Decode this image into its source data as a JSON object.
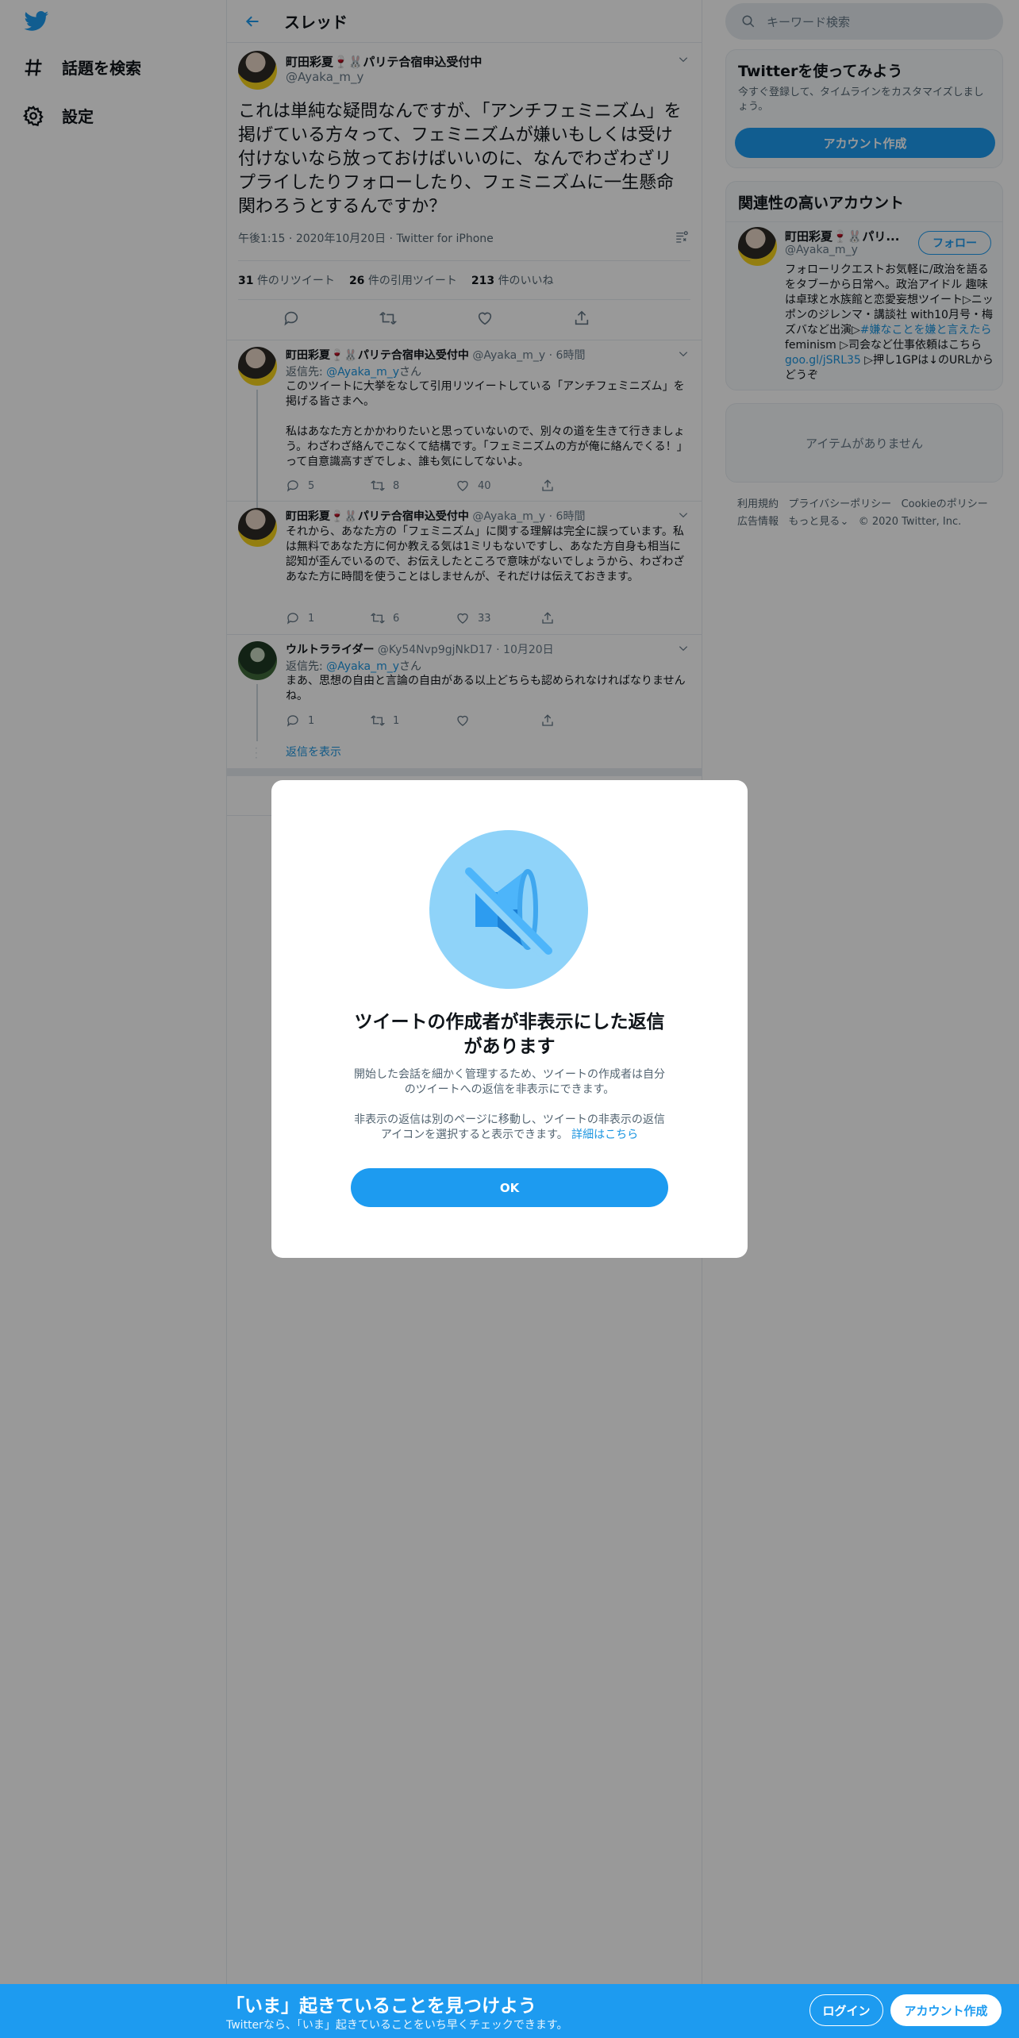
{
  "nav": {
    "explore_label": "話題を検索",
    "settings_label": "設定"
  },
  "header": {
    "title": "スレッド"
  },
  "main_tweet": {
    "name": "町田彩夏🍷🐰パリテ合宿申込受付中",
    "handle": "@Ayaka_m_y",
    "text": "これは単純な疑問なんですが、「アンチフェミニズム」を掲げている方々って、フェミニズムが嫌いもしくは受け付けないなら放っておけばいいのに、なんでわざわざリプライしたりフォローしたり、フェミニズムに一生懸命関わろうとするんですか？",
    "time": "午後1:15",
    "date": "2020年10月20日",
    "source": "Twitter for iPhone",
    "retweets_count": "31",
    "retweets_label": "件のリツイート",
    "quotes_count": "26",
    "quotes_label": "件の引用ツイート",
    "likes_count": "213",
    "likes_label": "件のいいね"
  },
  "replies": [
    {
      "name": "町田彩夏🍷🐰パリテ合宿申込受付中",
      "handle": "@Ayaka_m_y",
      "time": "6時間",
      "reply_to_prefix": "返信先: ",
      "reply_to": "@Ayaka_m_y",
      "reply_to_suffix": "さん",
      "text": "このツイートに大挙をなして引用リツイートしている「アンチフェミニズム」を掲げる皆さまへ。\n\n私はあなた方とかかわりたいと思っていないので、別々の道を生きて行きましょう。わざわざ絡んでこなくて結構です。「フェミニズムの方が俺に絡んでくる！」って自意識高すぎでしょ、誰も気にしてないよ。",
      "replies": "5",
      "retweets": "8",
      "likes": "40"
    },
    {
      "name": "町田彩夏🍷🐰パリテ合宿申込受付中",
      "handle": "@Ayaka_m_y",
      "time": "6時間",
      "text": "それから、あなた方の「フェミニズム」に関する理解は完全に誤っています。私は無料であなた方に何か教える気は1ミリもないですし、あなた方自身も相当に認知が歪んでいるので、お伝えしたところで意味がないでしょうから、わざわざあなた方に時間を使うことはしませんが、それだけは伝えておきます。",
      "replies": "1",
      "retweets": "6",
      "likes": "33"
    },
    {
      "name": "ウルトラライダー",
      "handle": "@Ky54Nvp9gjNkD17",
      "time": "10月20日",
      "reply_to_prefix": "返信先: ",
      "reply_to": "@Ayaka_m_y",
      "reply_to_suffix": "さん",
      "text": "まあ、思想の自由と言論の自由がある以上どちらも認められなければなりませんね。",
      "replies": "1",
      "retweets": "1",
      "likes": ""
    }
  ],
  "show_replies_label": "返信を表示",
  "search": {
    "placeholder": "キーワード検索"
  },
  "signup_card": {
    "title": "Twitterを使ってみよう",
    "subtitle": "今すぐ登録して、タイムラインをカスタマイズしましょう。",
    "button": "アカウント作成"
  },
  "related": {
    "title": "関連性の高いアカウント",
    "name": "町田彩夏🍷🐰パリ...",
    "handle": "@Ayaka_m_y",
    "follow": "フォロー",
    "bio_part1": "フォローリクエストお気軽に/政治を語るをタブーから日常へ。政治アイドル 趣味は卓球と水族館と恋愛妄想ツイート▷ニッポンのジレンマ・講談社 with10月号・梅ズバなど出演▷",
    "bio_link1": "#嫌なことを嫌と言えたら",
    "bio_part2": " feminism ▷司会など仕事依頼はこちら ",
    "bio_link2": "goo.gl/jSRL35",
    "bio_part3": " ▷押し1GPは↓のURLからどうぞ"
  },
  "trends_empty": "アイテムがありません",
  "footer": {
    "terms": "利用規約",
    "privacy": "プライバシーポリシー",
    "cookies": "Cookieのポリシー",
    "ads": "広告情報",
    "more": "もっと見る",
    "copyright": "© 2020 Twitter, Inc."
  },
  "modal": {
    "title": "ツイートの作成者が非表示にした返信があります",
    "body1": "開始した会話を細かく管理するため、ツイートの作成者は自分のツイートへの返信を非表示にできます。",
    "body2": "非表示の返信は別のページに移動し、ツイートの非表示の返信アイコンを選択すると表示できます。",
    "link": "詳細はこちら",
    "ok": "OK"
  },
  "bottom_bar": {
    "title": "「いま」起きていることを見つけよう",
    "subtitle": "Twitterなら、「いま」起きていることをいち早くチェックできます。",
    "login": "ログイン",
    "signup": "アカウント作成"
  }
}
